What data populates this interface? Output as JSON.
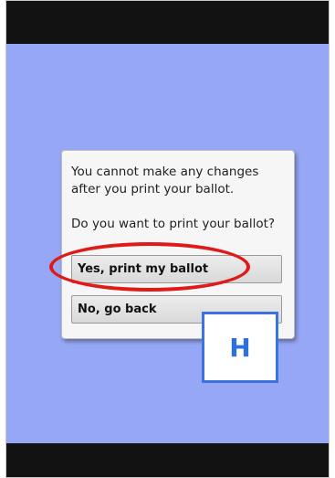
{
  "dialog": {
    "message_line": "You cannot make any changes after you print your ballot.",
    "question": "Do you want to print your ballot?",
    "confirm_label": "Yes, print my ballot",
    "cancel_label": "No, go back"
  },
  "badge": {
    "label": "H"
  },
  "colors": {
    "screen_background": "#96a8f5",
    "bars": "#121212",
    "highlight": "#e01919",
    "badge_accent": "#3d73e0"
  }
}
